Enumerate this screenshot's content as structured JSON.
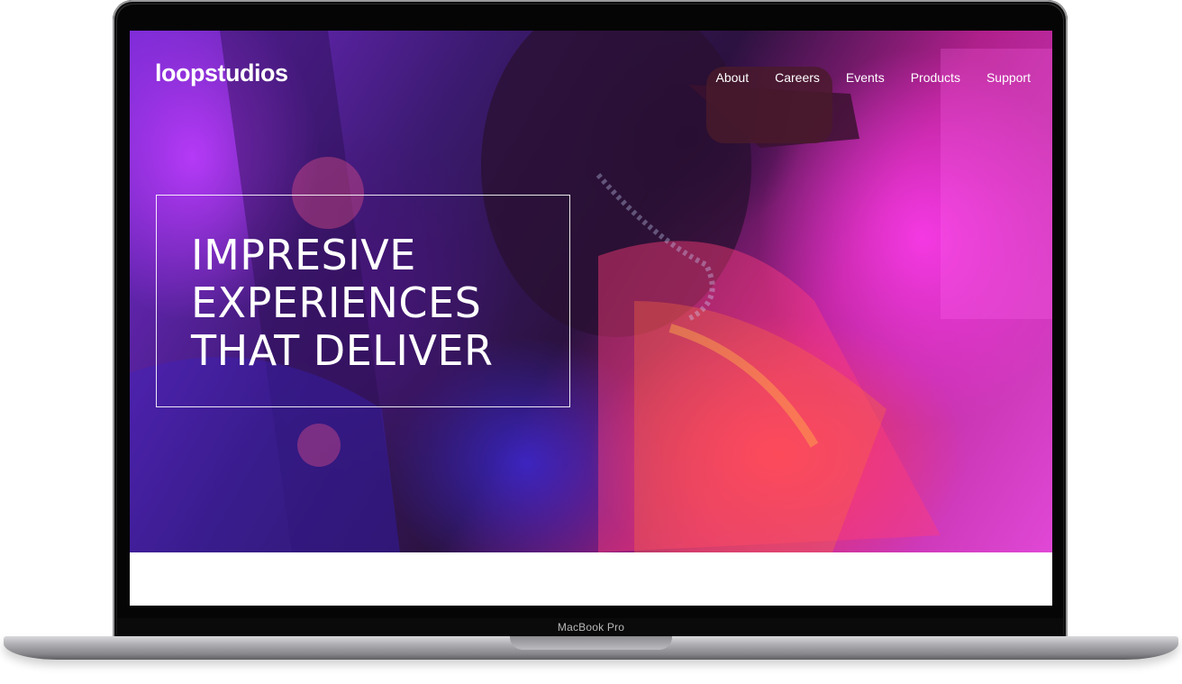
{
  "device": {
    "label": "MacBook Pro"
  },
  "header": {
    "logo_text": "loopstudios",
    "nav": [
      {
        "label": "About"
      },
      {
        "label": "Careers"
      },
      {
        "label": "Events"
      },
      {
        "label": "Products"
      },
      {
        "label": "Support"
      }
    ]
  },
  "hero": {
    "headline_lines": [
      "IMPRESIVE",
      "EXPERIENCES",
      "THAT DELIVER"
    ]
  },
  "colors": {
    "text": "#ffffff",
    "accent_magenta": "#e048d6",
    "accent_violet": "#7a2bd6",
    "accent_red": "#ff3c5a"
  },
  "icons": [
    "none"
  ]
}
